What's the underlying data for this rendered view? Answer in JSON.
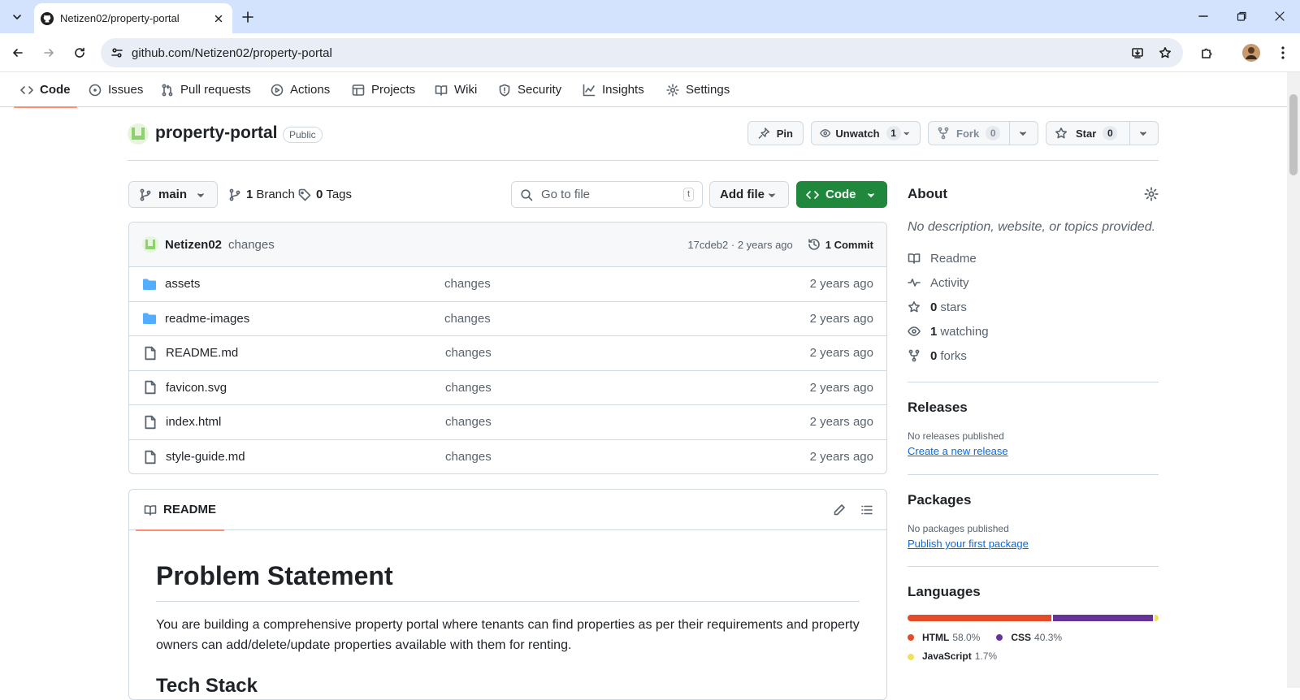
{
  "browser": {
    "tab_title": "Netizen02/property-portal",
    "url": "github.com/Netizen02/property-portal"
  },
  "nav": {
    "code": "Code",
    "issues": "Issues",
    "pulls": "Pull requests",
    "actions": "Actions",
    "projects": "Projects",
    "wiki": "Wiki",
    "security": "Security",
    "insights": "Insights",
    "settings": "Settings"
  },
  "repo": {
    "name": "property-portal",
    "visibility": "Public",
    "pin": "Pin",
    "unwatch": "Unwatch",
    "watch_count": "1",
    "fork": "Fork",
    "fork_count": "0",
    "star": "Star",
    "star_count": "0"
  },
  "toolbar": {
    "branch": "main",
    "branches_count": "1",
    "branches_label": "Branch",
    "tags_count": "0",
    "tags_label": "Tags",
    "go_to_file": "Go to file",
    "shortcut": "t",
    "add_file": "Add file",
    "code": "Code"
  },
  "commit": {
    "author": "Netizen02",
    "message": "changes",
    "hash_time": "17cdeb2 · 2 years ago",
    "commits": "1 Commit"
  },
  "files": [
    {
      "name": "assets",
      "type": "folder",
      "message": "changes",
      "age": "2 years ago"
    },
    {
      "name": "readme-images",
      "type": "folder",
      "message": "changes",
      "age": "2 years ago"
    },
    {
      "name": "README.md",
      "type": "file",
      "message": "changes",
      "age": "2 years ago"
    },
    {
      "name": "favicon.svg",
      "type": "file",
      "message": "changes",
      "age": "2 years ago"
    },
    {
      "name": "index.html",
      "type": "file",
      "message": "changes",
      "age": "2 years ago"
    },
    {
      "name": "style-guide.md",
      "type": "file",
      "message": "changes",
      "age": "2 years ago"
    }
  ],
  "readme": {
    "tab": "README",
    "h1": "Problem Statement",
    "p1": "You are building a comprehensive property portal where tenants can find properties as per their requirements and property owners can add/delete/update properties available with them for renting.",
    "h2": "Tech Stack"
  },
  "about": {
    "title": "About",
    "description": "No description, website, or topics provided.",
    "readme": "Readme",
    "activity": "Activity",
    "stars_count": "0",
    "stars_label": "stars",
    "watching_count": "1",
    "watching_label": "watching",
    "forks_count": "0",
    "forks_label": "forks"
  },
  "releases": {
    "title": "Releases",
    "none": "No releases published",
    "link": "Create a new release"
  },
  "packages": {
    "title": "Packages",
    "none": "No packages published",
    "link": "Publish your first package"
  },
  "languages": {
    "title": "Languages",
    "items": [
      {
        "name": "HTML",
        "percent": "58.0%",
        "value": 58.0,
        "color": "#e34c26"
      },
      {
        "name": "CSS",
        "percent": "40.3%",
        "value": 40.3,
        "color": "#663399"
      },
      {
        "name": "JavaScript",
        "percent": "1.7%",
        "value": 1.7,
        "color": "#f1e05a"
      }
    ]
  },
  "colors": {
    "primary_green": "#1f883d",
    "accent_underline": "#fd8c73",
    "link_blue": "#0969da",
    "folder_blue": "#54aeff"
  }
}
